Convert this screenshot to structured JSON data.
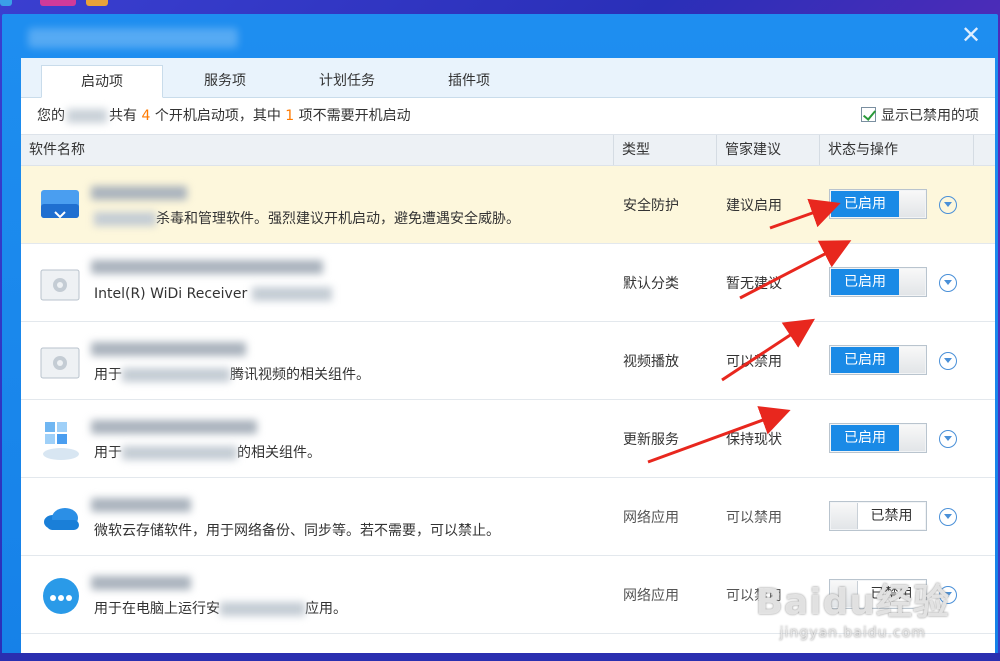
{
  "tabs": [
    {
      "label": "启动项",
      "active": true
    },
    {
      "label": "服务项",
      "active": false
    },
    {
      "label": "计划任务",
      "active": false
    },
    {
      "label": "插件项",
      "active": false
    }
  ],
  "summary": {
    "prefix": "您的",
    "mid1": "共有",
    "count_total": "4",
    "mid2": "个开机启动项，其中",
    "count_unneeded": "1",
    "suffix": "项不需要开机启动"
  },
  "show_disabled_label": "显示已禁用的项",
  "columns": {
    "name": "软件名称",
    "type": "类型",
    "advice": "管家建议",
    "status": "状态与操作"
  },
  "rows": [
    {
      "desc_visible": "杀毒和管理软件。强烈建议开机启动，避免遭遇安全威胁。",
      "type": "安全防护",
      "advice": "建议启用",
      "status": "已启用",
      "enabled": true,
      "highlight": true
    },
    {
      "desc_visible": "Intel(R) WiDi Receiver",
      "type": "默认分类",
      "advice": "暂无建议",
      "status": "已启用",
      "enabled": true,
      "highlight": false
    },
    {
      "desc_visible_pre": "用于",
      "desc_visible": "腾讯视频的相关组件。",
      "type": "视频播放",
      "advice": "可以禁用",
      "status": "已启用",
      "enabled": true,
      "highlight": false
    },
    {
      "desc_visible_pre": "用于",
      "desc_visible": "的相关组件。",
      "type": "更新服务",
      "advice": "保持现状",
      "status": "已启用",
      "enabled": true,
      "highlight": false
    },
    {
      "desc_visible": "微软云存储软件，用于网络备份、同步等。若不需要，可以禁止。",
      "type": "网络应用",
      "advice": "可以禁用",
      "status": "已禁用",
      "enabled": false,
      "highlight": false
    },
    {
      "desc_visible_pre": "用于在电脑上运行安",
      "desc_visible": "应用。",
      "type": "网络应用",
      "advice": "可以禁用",
      "status": "已禁用",
      "enabled": false,
      "highlight": false
    }
  ],
  "watermark": {
    "brand": "Baidu经验",
    "url": "jingyan.baidu.com"
  },
  "colors": {
    "accent": "#1a8ae6",
    "highlight_row": "#fdf7dc",
    "count": "#ff7a00",
    "arrow": "#e8271e"
  }
}
